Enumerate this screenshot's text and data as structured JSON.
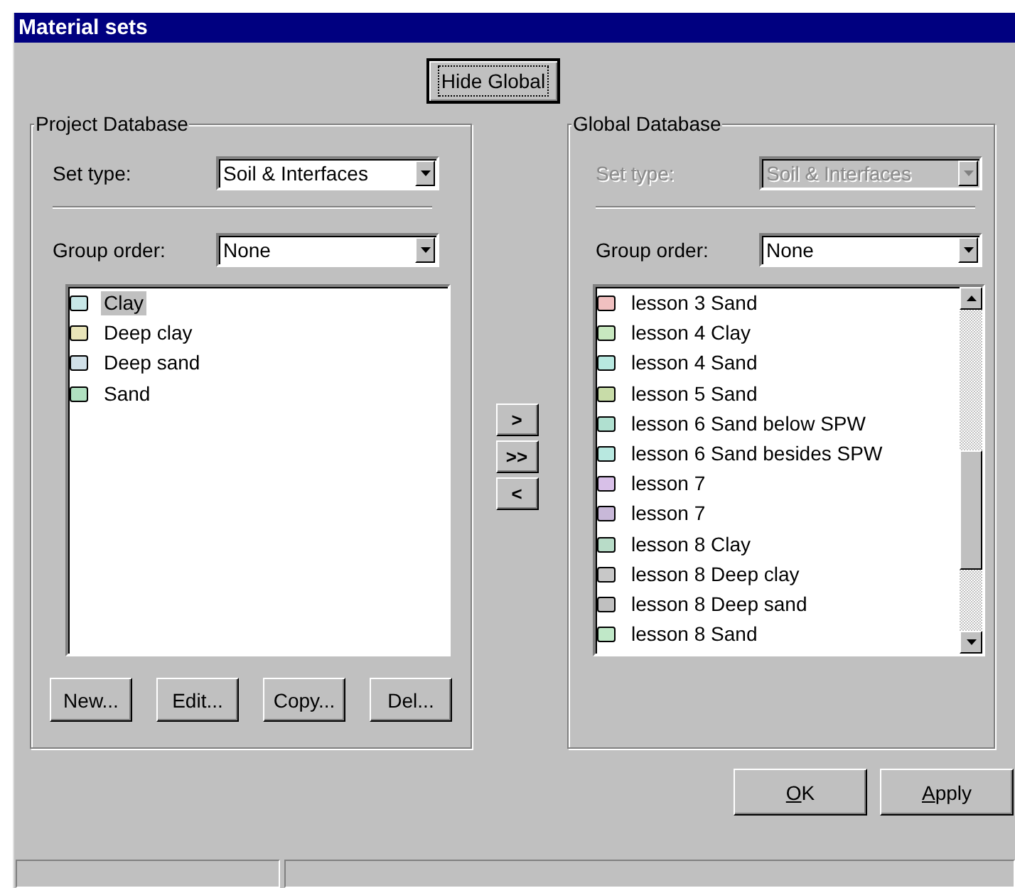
{
  "window": {
    "title": "Material sets"
  },
  "hide_global_button": "Hide Global",
  "project_database": {
    "title": "Project Database",
    "set_type": {
      "label": "Set type:",
      "value": "Soil & Interfaces",
      "disabled": false
    },
    "group_order": {
      "label": "Group order:",
      "value": "None",
      "disabled": false
    },
    "materials": [
      {
        "name": "Clay",
        "color": "#c8e8e8",
        "selected": true
      },
      {
        "name": "Deep clay",
        "color": "#e8e4b8",
        "selected": false
      },
      {
        "name": "Deep sand",
        "color": "#d0e0e8",
        "selected": false
      },
      {
        "name": "Sand",
        "color": "#b0e0c0",
        "selected": false
      }
    ],
    "buttons": [
      "New...",
      "Edit...",
      "Copy...",
      "Del..."
    ]
  },
  "transfer_buttons": [
    ">",
    ">>",
    "<"
  ],
  "global_database": {
    "title": "Global Database",
    "set_type": {
      "label": "Set type:",
      "value": "Soil & Interfaces",
      "disabled": true
    },
    "group_order": {
      "label": "Group order:",
      "value": "None",
      "disabled": false
    },
    "materials": [
      {
        "name": "lesson 3 Sand",
        "color": "#f0c0c0",
        "selected": false
      },
      {
        "name": "lesson 4 Clay",
        "color": "#c8e8c0",
        "selected": false
      },
      {
        "name": "lesson 4 Sand",
        "color": "#b8e8e0",
        "selected": false
      },
      {
        "name": "lesson 5 Sand",
        "color": "#c8dca8",
        "selected": false
      },
      {
        "name": "lesson 6 Sand below SPW",
        "color": "#b0e0d0",
        "selected": false
      },
      {
        "name": "lesson 6 Sand besides SPW",
        "color": "#b8e8e0",
        "selected": false
      },
      {
        "name": "lesson 7",
        "color": "#d8c0e8",
        "selected": false
      },
      {
        "name": "lesson 7",
        "color": "#c8b8d8",
        "selected": false
      },
      {
        "name": "lesson 8 Clay",
        "color": "#b8dcc8",
        "selected": false
      },
      {
        "name": "lesson 8 Deep clay",
        "color": "#c8c8c8",
        "selected": false
      },
      {
        "name": "lesson 8 Deep sand",
        "color": "#c0c0c0",
        "selected": false
      },
      {
        "name": "lesson 8 Sand",
        "color": "#c0e8c8",
        "selected": false
      }
    ]
  },
  "dialog_buttons": [
    {
      "label": "OK",
      "first_letter_underlined": true
    },
    {
      "label": "Apply",
      "first_letter_underlined": true
    }
  ]
}
